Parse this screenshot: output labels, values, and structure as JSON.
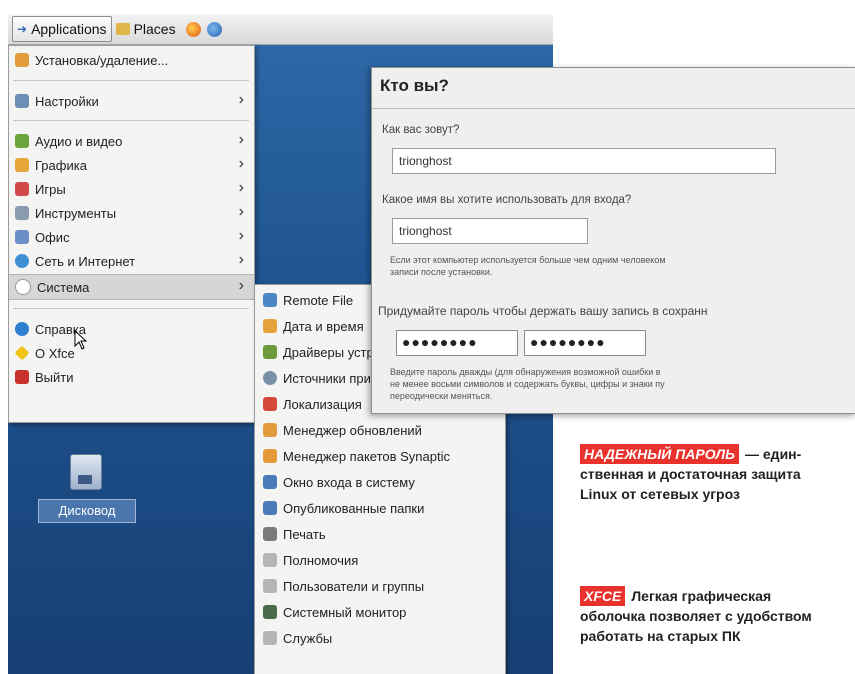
{
  "topbar": {
    "applications": "Applications",
    "places": "Places"
  },
  "menu": {
    "items": [
      {
        "label": "Установка/удаление...",
        "icon": "package-install-icon",
        "color": "#e39b3b"
      },
      {
        "label": "Настройки",
        "icon": "settings-icon",
        "color": "#6b8fb5"
      },
      {
        "label": "Аудио и видео",
        "icon": "multimedia-icon",
        "color": "#6aa63b"
      },
      {
        "label": "Графика",
        "icon": "graphics-icon",
        "color": "#e7a63a"
      },
      {
        "label": "Игры",
        "icon": "games-icon",
        "color": "#d04a4a"
      },
      {
        "label": "Инструменты",
        "icon": "tools-icon",
        "color": "#8a9bb0"
      },
      {
        "label": "Офис",
        "icon": "office-icon",
        "color": "#6b8fc8"
      },
      {
        "label": "Сеть и Интернет",
        "icon": "network-icon",
        "color": "#3f8fd6"
      },
      {
        "label": "Система",
        "icon": "system-icon",
        "color": "#9a9a9a"
      },
      {
        "label": "Справка",
        "icon": "help-icon",
        "color": "#2f7fd1"
      },
      {
        "label": "О Xfce",
        "icon": "about-icon",
        "color": "#f0c419"
      },
      {
        "label": "Выйти",
        "icon": "logout-icon",
        "color": "#c8312c"
      }
    ]
  },
  "submenu": {
    "items": [
      {
        "label": "Remote File",
        "icon": "remote-file-icon",
        "color": "#4d86c7"
      },
      {
        "label": "Дата и время",
        "icon": "datetime-icon",
        "color": "#e6a13a"
      },
      {
        "label": "Драйверы устройств",
        "icon": "drivers-icon",
        "color": "#6a9a3a"
      },
      {
        "label": "Источники приложений",
        "icon": "sources-icon",
        "color": "#7a8fa8"
      },
      {
        "label": "Локализация",
        "icon": "localization-icon",
        "color": "#d44a3a"
      },
      {
        "label": "Менеджер обновлений",
        "icon": "update-manager-icon",
        "color": "#e39b3b"
      },
      {
        "label": "Менеджер пакетов Synaptic",
        "icon": "synaptic-icon",
        "color": "#e39b3b"
      },
      {
        "label": "Окно входа в систему",
        "icon": "login-window-icon",
        "color": "#4a7ab8"
      },
      {
        "label": "Опубликованные папки",
        "icon": "shared-folders-icon",
        "color": "#4a7ab8"
      },
      {
        "label": "Печать",
        "icon": "printer-icon",
        "color": "#7a7a7a"
      },
      {
        "label": "Полномочия",
        "icon": "permissions-icon",
        "color": "#b5b5b5"
      },
      {
        "label": "Пользователи и группы",
        "icon": "users-icon",
        "color": "#b5b5b5"
      },
      {
        "label": "Системный монитор",
        "icon": "system-monitor-icon",
        "color": "#4a6a4a"
      },
      {
        "label": "Службы",
        "icon": "services-icon",
        "color": "#b5b5b5"
      }
    ]
  },
  "desktop_icon": {
    "label": "Дисковод",
    "icon": "floppy-drive-icon"
  },
  "dialog": {
    "title": "Кто вы?",
    "name_label": "Как вас зовут?",
    "name_value": "trionghost",
    "login_label": "Какое имя вы хотите использовать для входа?",
    "login_value": "trionghost",
    "login_note_1": "Если этот компьютер используется больше чем одним человеком",
    "login_note_2": "записи после установки.",
    "password_label": "Придумайте пароль чтобы держать вашу запись в сохранн",
    "password_mask": "●●●●●●●●",
    "password_confirm_mask": "●●●●●●●●",
    "password_note_1": "Введите пароль дважды (для обнаружения возможной ошибки в",
    "password_note_2": "не менее восьми символов и содержать буквы, цифры и знаки пу",
    "password_note_3": "переодически меняться."
  },
  "captions": {
    "password_tag": "НАДЕЖНЫЙ ПАРОЛЬ",
    "password_text_1": "— един-",
    "password_text_2": "ственная и достаточная защита",
    "password_text_3": "Linux от сетевых угроз",
    "xfce_tag": "XFCE",
    "xfce_text_1": "Легкая графическая",
    "xfce_text_2": "оболочка позволяет с удобством",
    "xfce_text_3": "работать на старых ПК"
  },
  "colors": {
    "tag_red": "#e8322b",
    "desktop_blue": "#1f5492"
  }
}
